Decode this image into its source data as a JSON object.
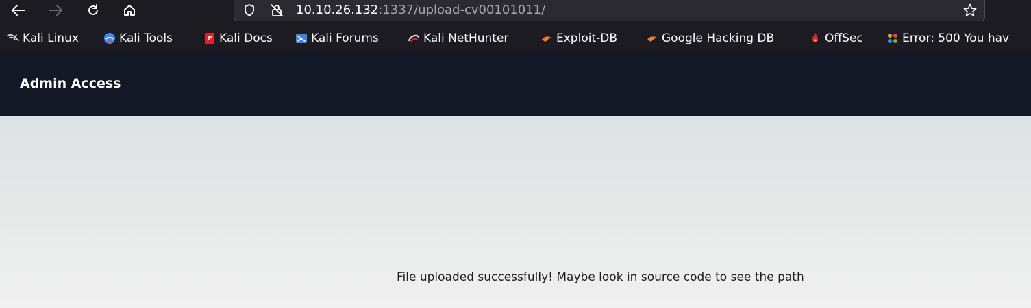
{
  "browser": {
    "url": {
      "host": "10.10.26.132",
      "rest": ":1337/upload-cv00101011/"
    },
    "icons": {
      "back": "back-arrow-icon",
      "forward": "forward-arrow-icon",
      "reload": "reload-icon",
      "home": "home-icon",
      "tracking": "shield-icon",
      "insecure": "insecure-lock-icon",
      "bookmark_star": "star-icon"
    }
  },
  "bookmarks": [
    {
      "label": "Kali Linux",
      "icon": "kali-dragon-icon"
    },
    {
      "label": "Kali Tools",
      "icon": "kali-tools-icon"
    },
    {
      "label": "Kali Docs",
      "icon": "kali-docs-icon"
    },
    {
      "label": "Kali Forums",
      "icon": "kali-forums-icon"
    },
    {
      "label": "Kali NetHunter",
      "icon": "nethunter-icon"
    },
    {
      "label": "Exploit-DB",
      "icon": "exploit-db-icon"
    },
    {
      "label": "Google Hacking DB",
      "icon": "ghdb-icon"
    },
    {
      "label": "OffSec",
      "icon": "offsec-icon"
    },
    {
      "label": "Error: 500 You hav",
      "icon": "joomla-icon"
    }
  ],
  "page": {
    "brand": "Admin Access",
    "message": "File uploaded successfully! Maybe look in source code to see the path"
  },
  "colors": {
    "chrome": "#1c1b22",
    "urlbar": "#2b2a33",
    "header": "#131827"
  }
}
